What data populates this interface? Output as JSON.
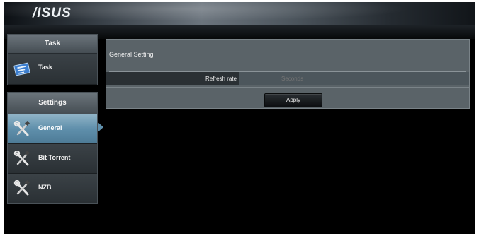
{
  "brand": {
    "logo_text": "/ISUS"
  },
  "sidebar": {
    "task_panel": {
      "title": "Task",
      "items": [
        {
          "label": "Task",
          "icon": "task-list-icon",
          "active": false
        }
      ]
    },
    "settings_panel": {
      "title": "Settings",
      "items": [
        {
          "label": "General",
          "icon": "wrench-screwdriver-icon",
          "active": true
        },
        {
          "label": "Bit Torrent",
          "icon": "wrench-screwdriver-icon",
          "active": false
        },
        {
          "label": "NZB",
          "icon": "wrench-screwdriver-icon",
          "active": false
        }
      ]
    }
  },
  "main": {
    "section_title": "General Setting",
    "refresh": {
      "label": "Refresh rate",
      "value": "",
      "placeholder": "Seconds"
    },
    "apply_label": "Apply"
  },
  "colors": {
    "active_item": "#5f8fab",
    "panel_bg": "#2c3236",
    "content_bg": "#5a6368",
    "page_bg": "#000000"
  }
}
